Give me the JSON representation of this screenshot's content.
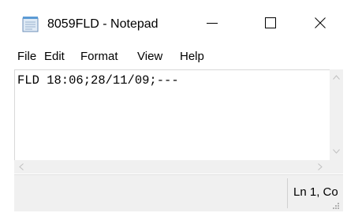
{
  "window": {
    "title": "8059FLD - Notepad",
    "app_icon": "notepad-icon",
    "controls": {
      "minimize_icon": "minimize-icon",
      "maximize_icon": "maximize-icon",
      "close_icon": "close-icon"
    }
  },
  "menu": {
    "items": [
      "File",
      "Edit",
      "Format",
      "View",
      "Help"
    ]
  },
  "editor": {
    "content": "FLD 18:06;28/11/09;---"
  },
  "status": {
    "position": "Ln 1, Co"
  },
  "colors": {
    "background": "#ffffff",
    "chrome": "#f0f0f0",
    "text": "#000000"
  }
}
